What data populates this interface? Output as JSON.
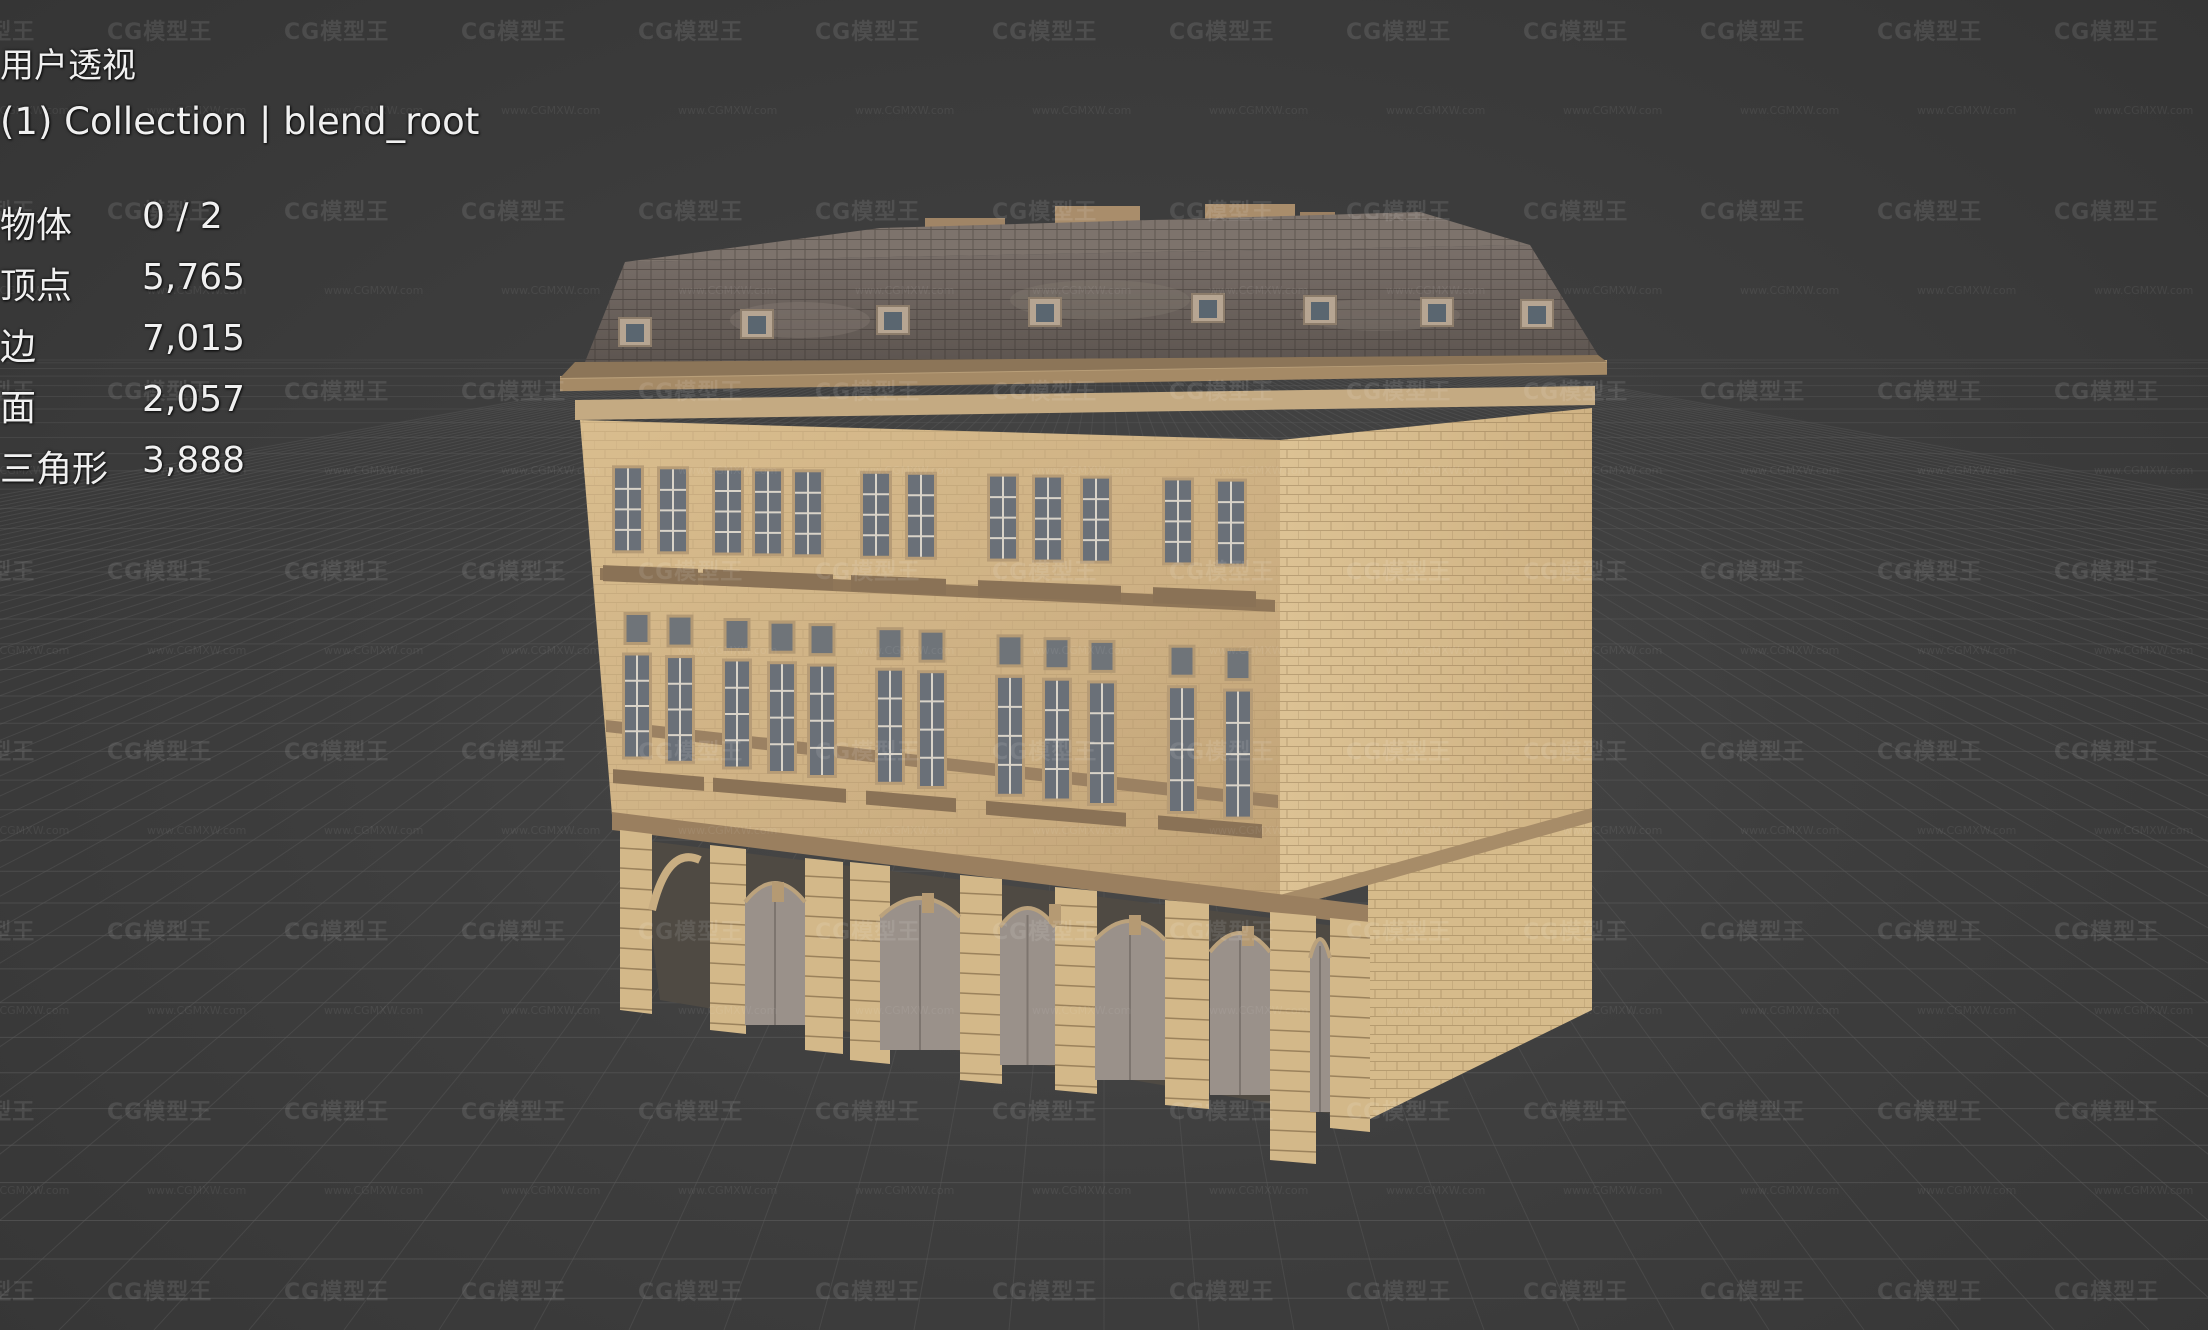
{
  "viewport": {
    "view_name": "用户透视",
    "collection": "(1) Collection | blend_root",
    "background_color": "#3d3d3d",
    "grid_color": "#5a5a5a"
  },
  "statistics": [
    {
      "label": "物体",
      "value": "0 / 2"
    },
    {
      "label": "顶点",
      "value": "5,765"
    },
    {
      "label": "边",
      "value": "7,015"
    },
    {
      "label": "面",
      "value": "2,057"
    },
    {
      "label": "三角形",
      "value": "3,888"
    }
  ],
  "watermark": {
    "text": "CG模型王",
    "url_text": "www.CGMXW.com"
  },
  "model": {
    "name": "building",
    "wall_color": "#d2b487",
    "roof_color": "#6b625e"
  }
}
